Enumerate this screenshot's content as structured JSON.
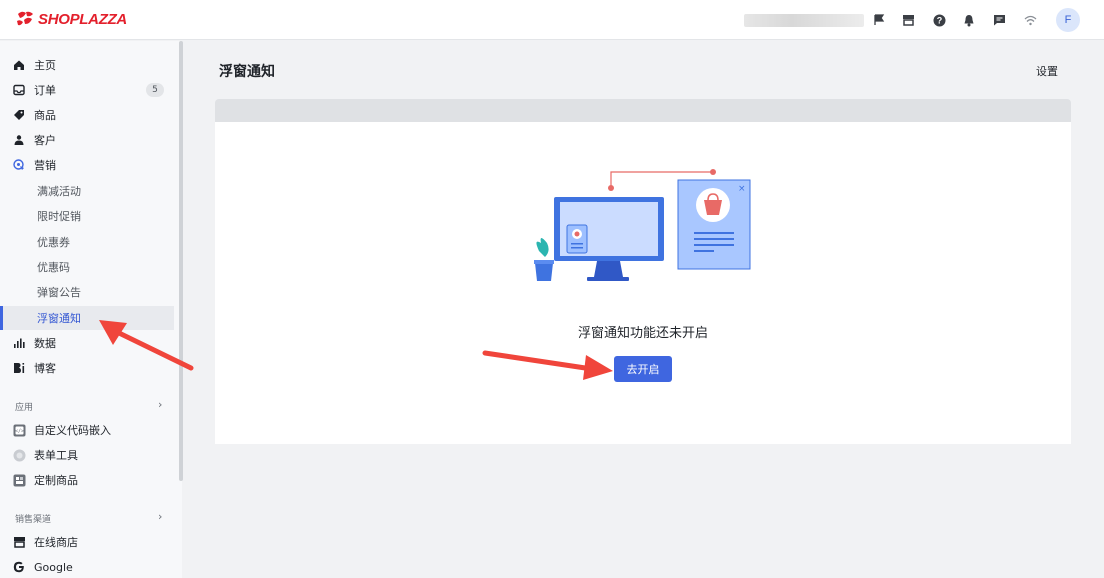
{
  "brand": {
    "name": "SHOPLAZZA",
    "color": "#e3202c"
  },
  "header": {
    "icons": [
      "flag-icon",
      "store-icon",
      "help-icon",
      "bell-icon",
      "chat-icon",
      "wifi-icon"
    ],
    "avatar_initial": "F"
  },
  "sidebar": {
    "items": [
      {
        "label": "主页",
        "icon": "home-icon"
      },
      {
        "label": "订单",
        "icon": "inbox-icon",
        "badge": "5"
      },
      {
        "label": "商品",
        "icon": "tag-icon"
      },
      {
        "label": "客户",
        "icon": "person-icon"
      },
      {
        "label": "营销",
        "icon": "marketing-icon"
      }
    ],
    "marketing_sub": [
      {
        "label": "满减活动"
      },
      {
        "label": "限时促销"
      },
      {
        "label": "优惠券"
      },
      {
        "label": "优惠码"
      },
      {
        "label": "弹窗公告"
      },
      {
        "label": "浮窗通知",
        "active": true
      }
    ],
    "items2": [
      {
        "label": "数据",
        "icon": "bar-chart-icon"
      },
      {
        "label": "博客",
        "icon": "blog-icon"
      }
    ],
    "apps_section": "应用",
    "apps": [
      {
        "label": "自定义代码嵌入",
        "icon": "code-icon"
      },
      {
        "label": "表单工具",
        "icon": "form-icon"
      },
      {
        "label": "定制商品",
        "icon": "custom-product-icon"
      }
    ],
    "channels_section": "销售渠道",
    "channels": [
      {
        "label": "在线商店",
        "icon": "store-icon"
      },
      {
        "label": "Google",
        "icon": "google-icon"
      }
    ]
  },
  "main": {
    "title": "浮窗通知",
    "settings_label": "设置",
    "empty_message": "浮窗通知功能还未开启",
    "enable_button": "去开启",
    "accent": "#3f66e0"
  }
}
